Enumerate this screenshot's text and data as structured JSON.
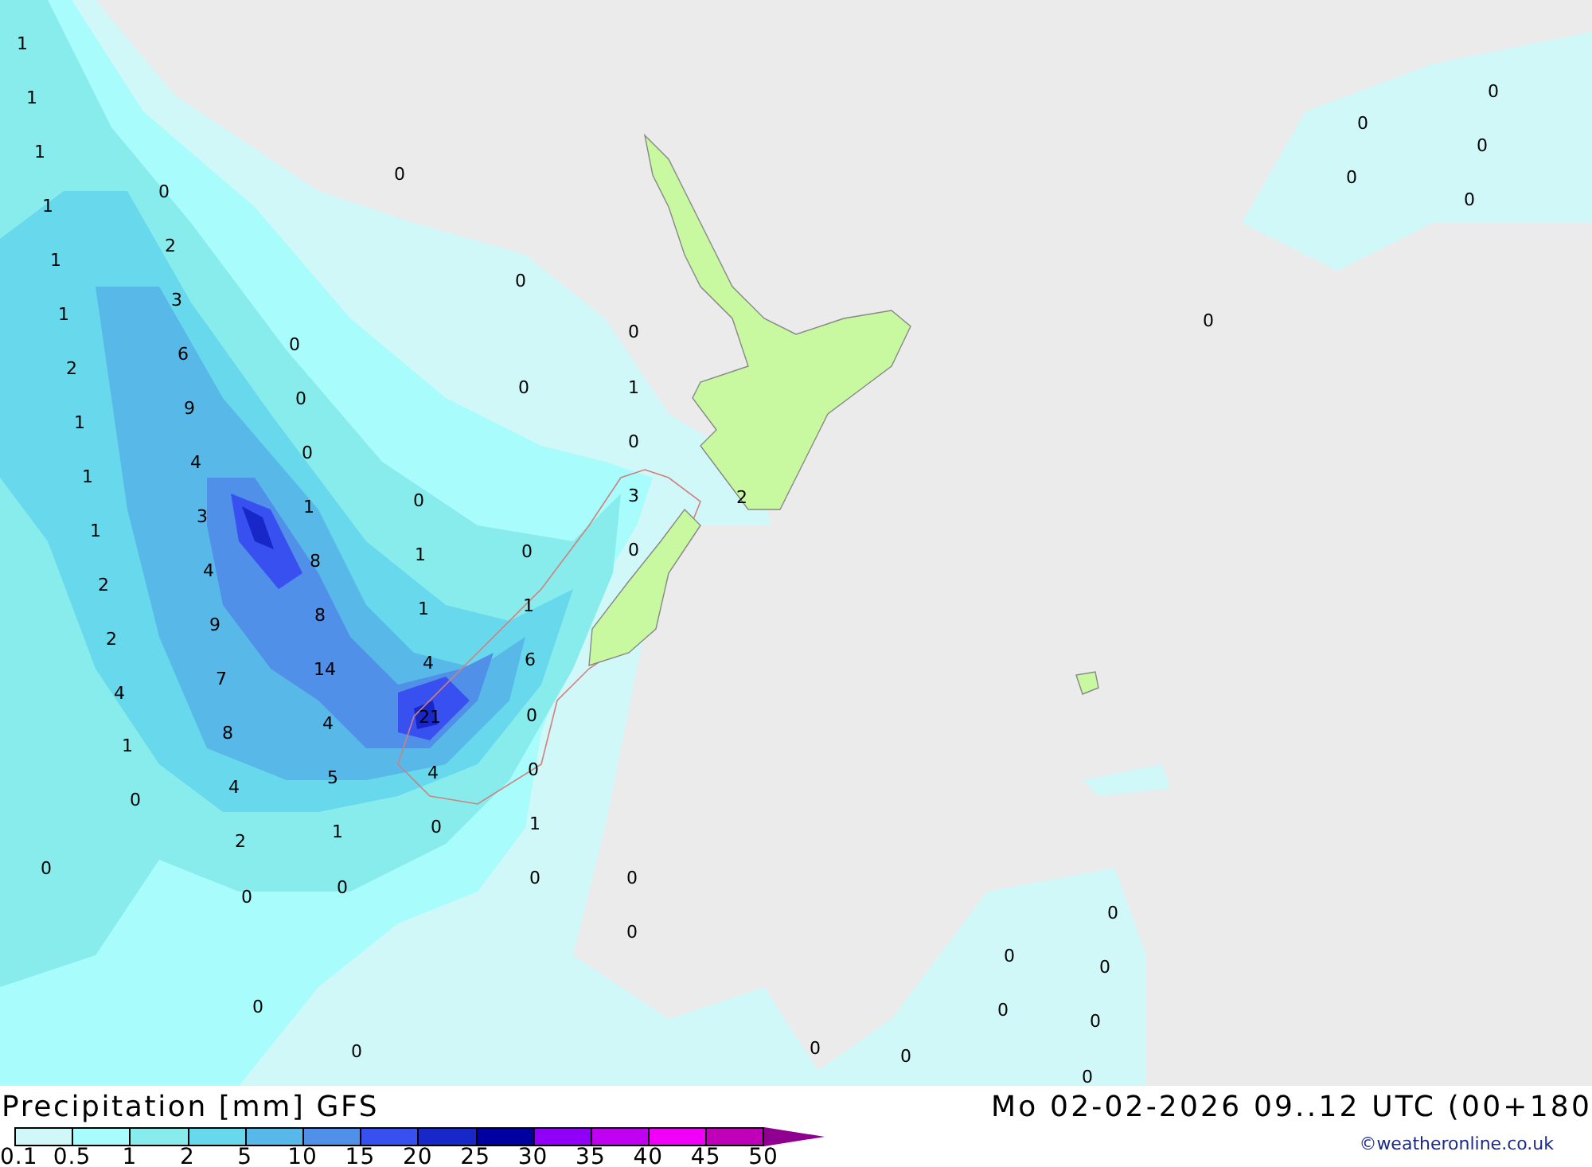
{
  "map": {
    "values": [
      "1",
      "1",
      "1",
      "1",
      "1",
      "1",
      "2",
      "1",
      "1",
      "1",
      "2",
      "2",
      "4",
      "1",
      "0",
      "0",
      "0",
      "2",
      "3",
      "6",
      "9",
      "4",
      "3",
      "4",
      "9",
      "7",
      "8",
      "4",
      "2",
      "0",
      "0",
      "0",
      "0",
      "0",
      "1",
      "8",
      "8",
      "14",
      "4",
      "5",
      "1",
      "0",
      "0",
      "0",
      "0",
      "1",
      "1",
      "4",
      "21",
      "4",
      "0",
      "0",
      "0",
      "0",
      "1",
      "6",
      "0",
      "0",
      "1",
      "0",
      "0",
      "1",
      "0",
      "3",
      "0",
      "0",
      "0",
      "2",
      "0",
      "0",
      "0",
      "0",
      "0",
      "0",
      "0",
      "0",
      "0",
      "0",
      "0",
      "0",
      "0",
      "0"
    ]
  },
  "legend": {
    "title": "Precipitation [mm] GFS",
    "timestamp": "Mo 02-02-2026 09..12 UTC (00+180",
    "steps": [
      {
        "label": "0.1",
        "color": "#d0f8f8"
      },
      {
        "label": "0.5",
        "color": "#a8fcfc"
      },
      {
        "label": "1",
        "color": "#88ecec"
      },
      {
        "label": "2",
        "color": "#68d8ec"
      },
      {
        "label": "5",
        "color": "#58b8e8"
      },
      {
        "label": "10",
        "color": "#5090e8"
      },
      {
        "label": "15",
        "color": "#3850f0"
      },
      {
        "label": "20",
        "color": "#1828c8"
      },
      {
        "label": "25",
        "color": "#0000a0"
      },
      {
        "label": "30",
        "color": "#9000f8"
      },
      {
        "label": "35",
        "color": "#c000f0"
      },
      {
        "label": "40",
        "color": "#f000f8"
      },
      {
        "label": "45",
        "color": "#c000b8"
      }
    ],
    "end_label": "50",
    "credit": "©weatheronline.co.uk"
  }
}
